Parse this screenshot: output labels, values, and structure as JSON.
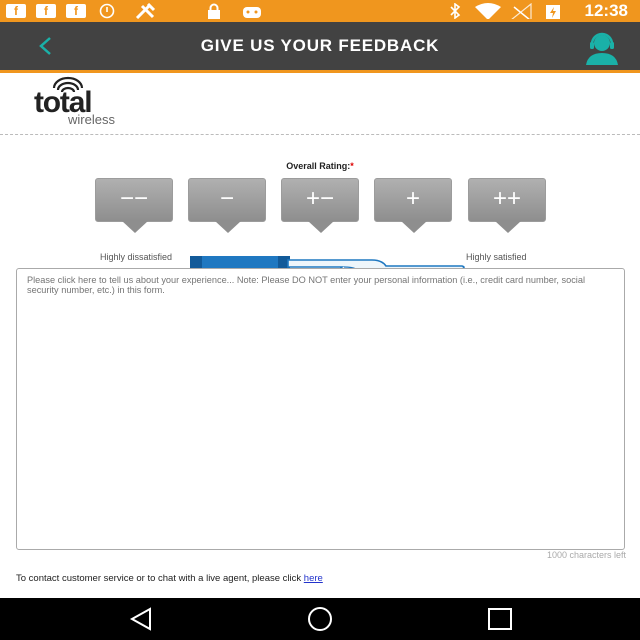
{
  "status_bar": {
    "time": "12:38",
    "notification_icons": [
      "facebook-icon",
      "facebook-icon",
      "facebook-icon",
      "alarm-icon",
      "tools-icon",
      "lock-icon",
      "game-controller-icon"
    ],
    "system_icons": [
      "bluetooth-icon",
      "wifi-icon",
      "no-signal-icon",
      "battery-charging-icon"
    ]
  },
  "app_bar": {
    "title": "GIVE US YOUR FEEDBACK",
    "back_icon": "chevron-left-icon",
    "agent_icon": "support-agent-icon"
  },
  "logo": {
    "text_main": "total",
    "text_sub": "wireless"
  },
  "rating": {
    "label": "Overall Rating:",
    "required_mark": "*",
    "options": [
      "−−",
      "−",
      "+−",
      "+",
      "++"
    ],
    "low_label": "Highly dissatisfied",
    "high_label": "Highly satisfied"
  },
  "feedback": {
    "placeholder": "Please click here to tell us about your experience... Note: Please DO NOT enter your personal information (i.e., credit card number, social security number, etc.) in this form.",
    "char_count": "1000 characters left"
  },
  "contact": {
    "text": "To contact customer service or to chat with a live agent, please click ",
    "link_label": "here"
  },
  "nav_bar": {
    "icons": [
      "back-triangle-icon",
      "home-circle-icon",
      "recents-square-icon"
    ]
  },
  "colors": {
    "status_bar": "#f0961e",
    "app_bar": "#424242",
    "accent": "#1ab1a8",
    "rating_button": "#9e9e9e"
  }
}
